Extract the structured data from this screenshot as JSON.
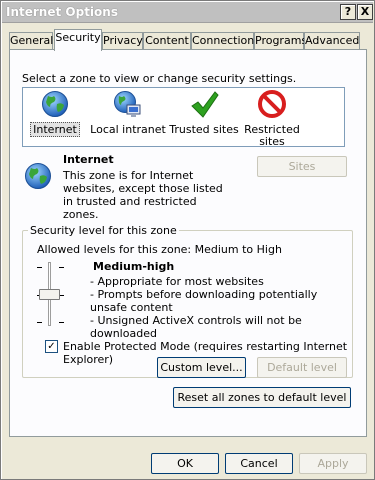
{
  "window": {
    "title": "Internet Options"
  },
  "titlebar_buttons": {
    "help": "?",
    "close": "X"
  },
  "tabs": [
    {
      "label": "General"
    },
    {
      "label": "Security"
    },
    {
      "label": "Privacy"
    },
    {
      "label": "Content"
    },
    {
      "label": "Connections"
    },
    {
      "label": "Programs"
    },
    {
      "label": "Advanced"
    }
  ],
  "active_tab": "Security",
  "zones": {
    "prompt": "Select a zone to view or change security settings.",
    "items": [
      {
        "label": "Internet",
        "icon": "globe-icon",
        "selected": true
      },
      {
        "label": "Local intranet",
        "icon": "intranet-globe-icon",
        "selected": false
      },
      {
        "label": "Trusted sites",
        "icon": "checkmark-icon",
        "selected": false
      },
      {
        "label": "Restricted sites",
        "icon": "restricted-icon",
        "selected": false
      }
    ]
  },
  "zone_info": {
    "title": "Internet",
    "description": "This zone is for Internet websites, except those listed in trusted and restricted zones.",
    "sites_button": "Sites"
  },
  "security_level": {
    "group_label": "Security level for this zone",
    "allowed": "Allowed levels for this zone: Medium to High",
    "level_name": "Medium-high",
    "bullets": [
      "- Appropriate for most websites",
      "- Prompts before downloading potentially unsafe content",
      "- Unsigned ActiveX controls will not be downloaded"
    ],
    "slider_level_index": 1,
    "protected_mode_label": "Enable Protected Mode (requires restarting Internet Explorer)",
    "protected_mode_checked": true,
    "custom_level_button": "Custom level...",
    "default_level_button": "Default level"
  },
  "reset_button": "Reset all zones to default level",
  "dialog_buttons": {
    "ok": "OK",
    "cancel": "Cancel",
    "apply": "Apply"
  },
  "colors": {
    "accent_green": "#2da11f",
    "restricted_red": "#d81e1e",
    "globe_blue": "#2b6bc8"
  }
}
